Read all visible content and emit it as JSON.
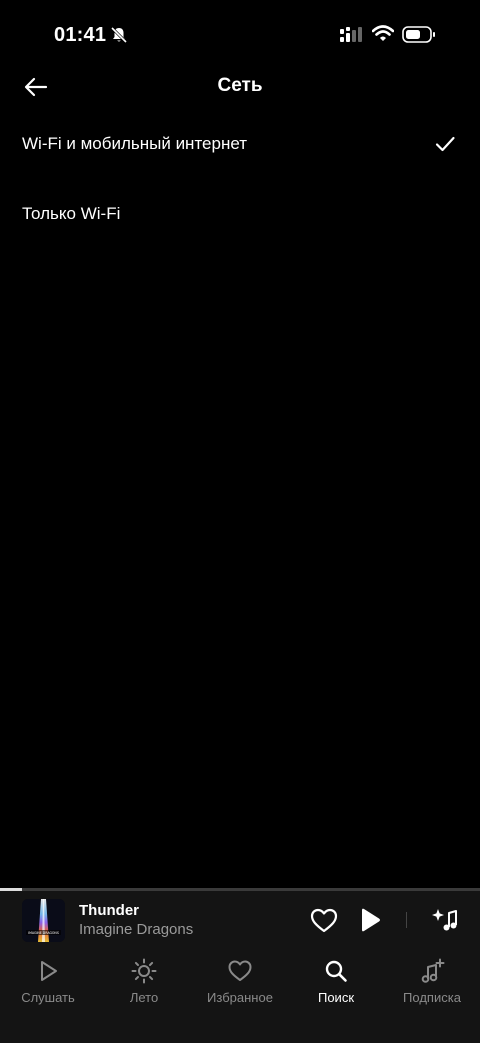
{
  "status_bar": {
    "time": "01:41",
    "icons": [
      "bell-mute-icon",
      "cellular-signal-icon",
      "wifi-icon",
      "battery-icon"
    ]
  },
  "header": {
    "title": "Сеть",
    "back_icon": "arrow-left-icon"
  },
  "options": [
    {
      "label": "Wi-Fi и мобильный интернет",
      "selected": true
    },
    {
      "label": "Только Wi-Fi",
      "selected": false
    }
  ],
  "mini_player": {
    "title": "Thunder",
    "artist": "Imagine Dragons",
    "cover_text": "IMAGINE DRAGONS",
    "progress": 0.046,
    "icons": [
      "heart-icon",
      "play-icon",
      "sparkle-note-icon"
    ]
  },
  "bottom_nav": {
    "items": [
      {
        "label": "Слушать",
        "icon": "play-outline-icon",
        "active": false
      },
      {
        "label": "Лето",
        "icon": "sun-icon",
        "active": false
      },
      {
        "label": "Избранное",
        "icon": "heart-icon",
        "active": false
      },
      {
        "label": "Поиск",
        "icon": "search-icon",
        "active": true
      },
      {
        "label": "Подписка",
        "icon": "music-plus-icon",
        "active": false
      }
    ]
  },
  "colors": {
    "background": "#000000",
    "panel": "#141414",
    "text_primary": "#ffffff",
    "text_secondary": "#9a9a9a"
  }
}
